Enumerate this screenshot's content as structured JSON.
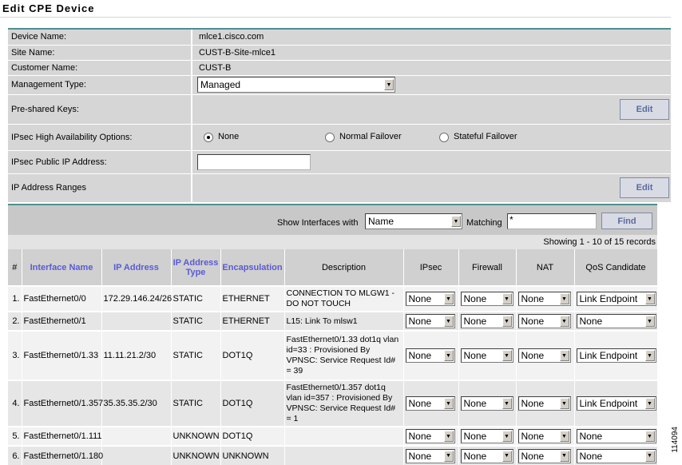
{
  "page_title": "Edit CPE Device",
  "form": {
    "device_name_label": "Device Name:",
    "device_name": "mlce1.cisco.com",
    "site_name_label": "Site Name:",
    "site_name": "CUST-B-Site-mlce1",
    "customer_name_label": "Customer Name:",
    "customer_name": "CUST-B",
    "management_type_label": "Management Type:",
    "management_type": "Managed",
    "preshared_keys_label": "Pre-shared Keys:",
    "preshared_edit": "Edit",
    "ipsec_ha_label": "IPsec High Availability Options:",
    "ha_options": [
      "None",
      "Normal Failover",
      "Stateful Failover"
    ],
    "ipsec_public_ip_label": "IPsec Public IP Address:",
    "ipsec_public_ip": "",
    "ip_ranges_label": "IP Address Ranges",
    "ip_ranges_edit": "Edit"
  },
  "find": {
    "show_label": "Show Interfaces with",
    "field": "Name",
    "matching_label": "Matching",
    "matching_value": "*",
    "find_button": "Find",
    "records_text": "Showing 1 - 10 of 15 records"
  },
  "table": {
    "headers": [
      "#",
      "Interface Name",
      "IP Address",
      "IP Address Type",
      "Encapsulation",
      "Description",
      "IPsec",
      "Firewall",
      "NAT",
      "QoS Candidate"
    ],
    "rows": [
      {
        "num": "1.",
        "name": "FastEthernet0/0",
        "ip": "172.29.146.24/26",
        "type": "STATIC",
        "encap": "ETHERNET",
        "desc": "CONNECTION TO MLGW1 - DO NOT TOUCH",
        "ipsec": "None",
        "firewall": "None",
        "nat": "None",
        "qos": "Link Endpoint"
      },
      {
        "num": "2.",
        "name": "FastEthernet0/1",
        "ip": "",
        "type": "STATIC",
        "encap": "ETHERNET",
        "desc": "L15: Link To mlsw1",
        "ipsec": "None",
        "firewall": "None",
        "nat": "None",
        "qos": "None"
      },
      {
        "num": "3.",
        "name": "FastEthernet0/1.33",
        "ip": "11.11.21.2/30",
        "type": "STATIC",
        "encap": "DOT1Q",
        "desc": "FastEthernet0/1.33 dot1q vlan id=33 : Provisioned By VPNSC: Service Request Id# = 39",
        "ipsec": "None",
        "firewall": "None",
        "nat": "None",
        "qos": "Link Endpoint"
      },
      {
        "num": "4.",
        "name": "FastEthernet0/1.357",
        "ip": "35.35.35.2/30",
        "type": "STATIC",
        "encap": "DOT1Q",
        "desc": "FastEthernet0/1.357 dot1q vlan id=357 : Provisioned By VPNSC: Service Request Id# = 1",
        "ipsec": "None",
        "firewall": "None",
        "nat": "None",
        "qos": "Link Endpoint"
      },
      {
        "num": "5.",
        "name": "FastEthernet0/1.111",
        "ip": "",
        "type": "UNKNOWN",
        "encap": "DOT1Q",
        "desc": "",
        "ipsec": "None",
        "firewall": "None",
        "nat": "None",
        "qos": "None"
      },
      {
        "num": "6.",
        "name": "FastEthernet0/1.180",
        "ip": "",
        "type": "UNKNOWN",
        "encap": "UNKNOWN",
        "desc": "",
        "ipsec": "None",
        "firewall": "None",
        "nat": "None",
        "qos": "None"
      }
    ]
  },
  "figure_number": "114094"
}
